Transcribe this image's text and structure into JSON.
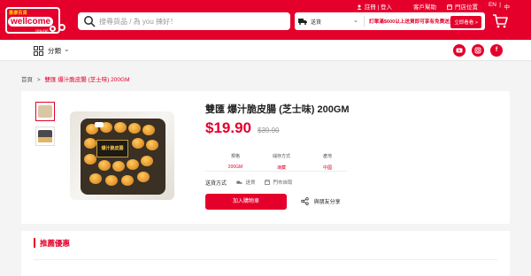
{
  "header": {
    "logo": {
      "tag": "惠康百貨",
      "brand": "wellcome",
      "online": "ONLINE"
    },
    "search_placeholder": "搜尋貨品 / 為 you 揀好！",
    "top_links": [
      "註冊 | 登入",
      "客戶幫助",
      "門店位置",
      "EN",
      "中"
    ],
    "delivery_label": "送貨",
    "promo_text": "訂單滿$600以上送貨即可享有免費送貨優惠",
    "promo_button": "立即看看 >"
  },
  "categories": {
    "label": "分類"
  },
  "social": [
    "youtube",
    "instagram",
    "facebook"
  ],
  "breadcrumb": {
    "home": "首頁",
    "current": "雙匯 爆汁脆皮腸 (芝士味) 200GM"
  },
  "product": {
    "title": "雙匯 爆汁脆皮腸 (芝士味) 200GM",
    "price": "$19.90",
    "old_price": "$39.90",
    "package_label": "爆汁脆皮腸",
    "specs": [
      {
        "key": "規格",
        "value": "200GM"
      },
      {
        "key": "儲存方式",
        "value": "凍藏"
      },
      {
        "key": "產地",
        "value": "中國"
      }
    ],
    "delivery_method_label": "送貨方式",
    "delivery_options": [
      "送貨",
      "門市自取"
    ],
    "add_to_cart": "加入購物車",
    "share": "與朋友分享"
  },
  "recommendations": {
    "title": "推薦優惠"
  },
  "colors": {
    "brand_red": "#e4002b"
  }
}
